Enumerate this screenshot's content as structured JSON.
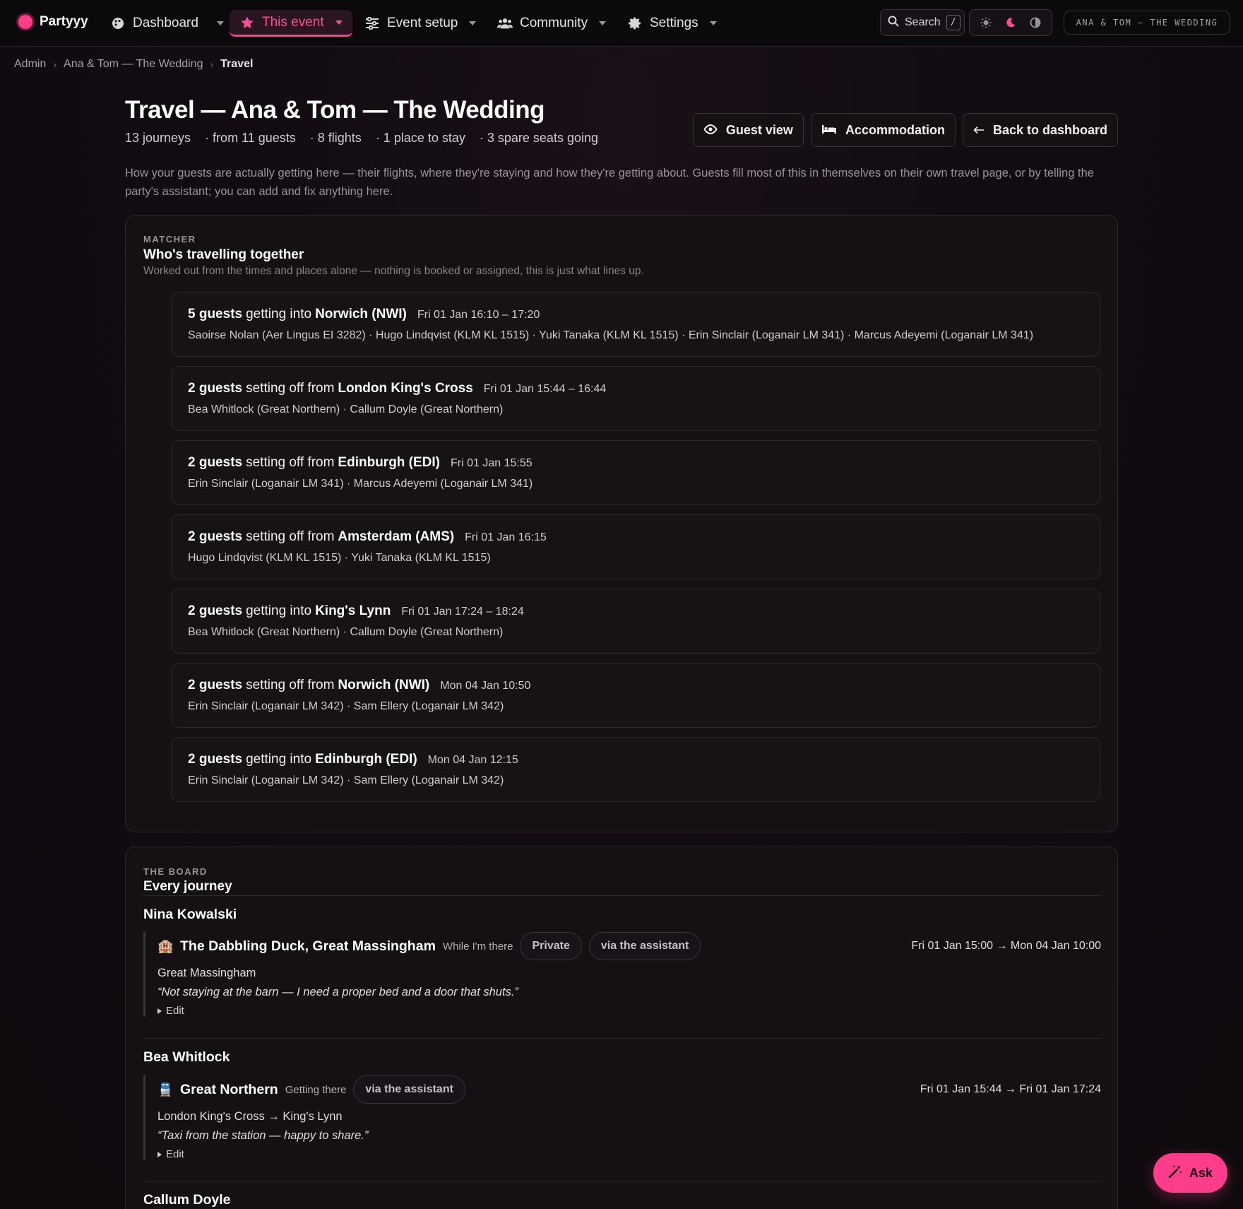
{
  "nav": {
    "brand": "Partyyy",
    "items": [
      {
        "label": "Dashboard",
        "icon": "palette-icon"
      },
      {
        "label": "This event",
        "icon": "star-icon"
      },
      {
        "label": "Event setup",
        "icon": "sliders-icon"
      },
      {
        "label": "Community",
        "icon": "users-icon"
      },
      {
        "label": "Settings",
        "icon": "gear-icon"
      }
    ],
    "search_label": "Search",
    "search_kbd": "/",
    "event_pill": "ANA & TOM — THE WEDDING"
  },
  "breadcrumb": [
    "Admin",
    "Ana & Tom — The Wedding",
    "Travel"
  ],
  "header": {
    "title": "Travel — Ana & Tom — The Wedding",
    "stats": [
      "13 journeys",
      "· from 11 guests",
      "· 8 flights",
      "· 1 place to stay",
      "· 3 spare seats going"
    ],
    "buttons": {
      "guest_view": "Guest view",
      "accommodation": "Accommodation",
      "back": "Back to dashboard"
    },
    "intro": "How your guests are actually getting here — their flights, where they're staying and how they're getting about. Guests fill most of this in themselves on their own travel page, or by telling the party's assistant; you can add and fix anything here."
  },
  "matcher": {
    "kicker": "MATCHER",
    "title": "Who's travelling together",
    "subtitle": "Worked out from the times and places alone — nothing is booked or assigned, this is just what lines up.",
    "groups": [
      {
        "count": "5 guests",
        "verb": "getting into",
        "place": "Norwich (NWI)",
        "when": "Fri 01 Jan 16:10 – 17:20",
        "people": "Saoirse Nolan (Aer Lingus EI 3282) · Hugo Lindqvist (KLM KL 1515) · Yuki Tanaka (KLM KL 1515) · Erin Sinclair (Loganair LM 341) · Marcus Adeyemi (Loganair LM 341)"
      },
      {
        "count": "2 guests",
        "verb": "setting off from",
        "place": "London King's Cross",
        "when": "Fri 01 Jan 15:44 – 16:44",
        "people": "Bea Whitlock (Great Northern) · Callum Doyle (Great Northern)"
      },
      {
        "count": "2 guests",
        "verb": "setting off from",
        "place": "Edinburgh (EDI)",
        "when": "Fri 01 Jan 15:55",
        "people": "Erin Sinclair (Loganair LM 341) · Marcus Adeyemi (Loganair LM 341)"
      },
      {
        "count": "2 guests",
        "verb": "setting off from",
        "place": "Amsterdam (AMS)",
        "when": "Fri 01 Jan 16:15",
        "people": "Hugo Lindqvist (KLM KL 1515) · Yuki Tanaka (KLM KL 1515)"
      },
      {
        "count": "2 guests",
        "verb": "getting into",
        "place": "King's Lynn",
        "when": "Fri 01 Jan 17:24 – 18:24",
        "people": "Bea Whitlock (Great Northern) · Callum Doyle (Great Northern)"
      },
      {
        "count": "2 guests",
        "verb": "setting off from",
        "place": "Norwich (NWI)",
        "when": "Mon 04 Jan 10:50",
        "people": "Erin Sinclair (Loganair LM 342) · Sam Ellery (Loganair LM 342)"
      },
      {
        "count": "2 guests",
        "verb": "getting into",
        "place": "Edinburgh (EDI)",
        "when": "Mon 04 Jan 12:15",
        "people": "Erin Sinclair (Loganair LM 342) · Sam Ellery (Loganair LM 342)"
      }
    ]
  },
  "board": {
    "kicker": "THE BOARD",
    "title": "Every journey",
    "people": [
      {
        "name": "Nina Kowalski",
        "journey": {
          "icon": "hotel-icon",
          "title": "The Dabbling Duck, Great Massingham",
          "kind": "While I'm there",
          "chips": [
            "Private",
            "via the assistant"
          ],
          "dates": "Fri 01 Jan 15:00 → Mon 04 Jan 10:00",
          "place": "Great Massingham",
          "quote": "“Not staying at the barn — I need a proper bed and a door that shuts.”",
          "edit": "Edit"
        }
      },
      {
        "name": "Bea Whitlock",
        "journey": {
          "icon": "train-icon",
          "title": "Great Northern",
          "kind": "Getting there",
          "chips": [
            "via the assistant"
          ],
          "dates": "Fri 01 Jan 15:44 → Fri 01 Jan 17:24",
          "place": "London King's Cross → King's Lynn",
          "quote": "“Taxi from the station — happy to share.”",
          "edit": "Edit"
        }
      },
      {
        "name": "Callum Doyle"
      }
    ]
  },
  "ask_label": "Ask",
  "colors": {
    "accent": "#ff3d8a",
    "background": "#110c11",
    "card": "#141014"
  }
}
